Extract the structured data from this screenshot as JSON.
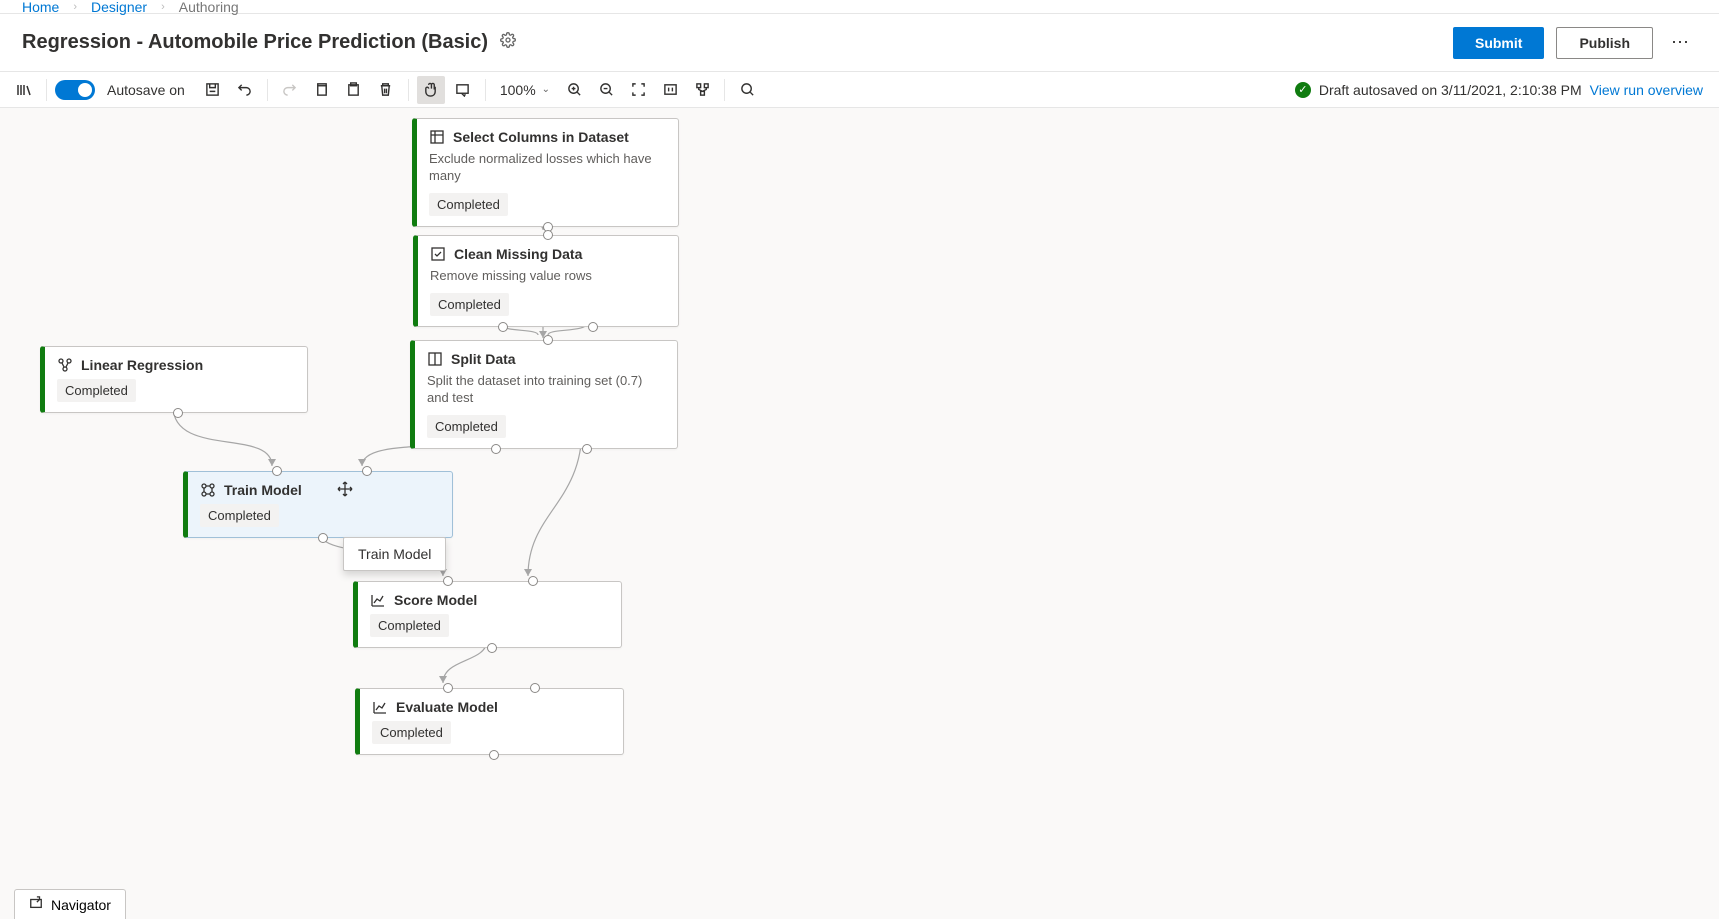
{
  "breadcrumb": {
    "home": "Home",
    "designer": "Designer",
    "authoring": "Authoring"
  },
  "header": {
    "title": "Regression - Automobile Price Prediction (Basic)",
    "submit": "Submit",
    "publish": "Publish"
  },
  "toolbar": {
    "autosave_label": "Autosave on",
    "zoom": "100%",
    "status_text": "Draft autosaved on 3/11/2021, 2:10:38 PM",
    "overview_link": "View run overview"
  },
  "nodes": {
    "select_columns": {
      "title": "Select Columns in Dataset",
      "desc": "Exclude normalized losses which have many",
      "status": "Completed"
    },
    "clean_missing": {
      "title": "Clean Missing Data",
      "desc": "Remove missing value rows",
      "status": "Completed"
    },
    "split_data": {
      "title": "Split Data",
      "desc": "Split the dataset into training set (0.7) and test",
      "status": "Completed"
    },
    "linear_regression": {
      "title": "Linear Regression",
      "status": "Completed"
    },
    "train_model": {
      "title": "Train Model",
      "status": "Completed"
    },
    "score_model": {
      "title": "Score Model",
      "status": "Completed"
    },
    "evaluate_model": {
      "title": "Evaluate Model",
      "status": "Completed"
    }
  },
  "tooltip": {
    "train_model": "Train Model"
  },
  "navigator": {
    "label": "Navigator"
  }
}
